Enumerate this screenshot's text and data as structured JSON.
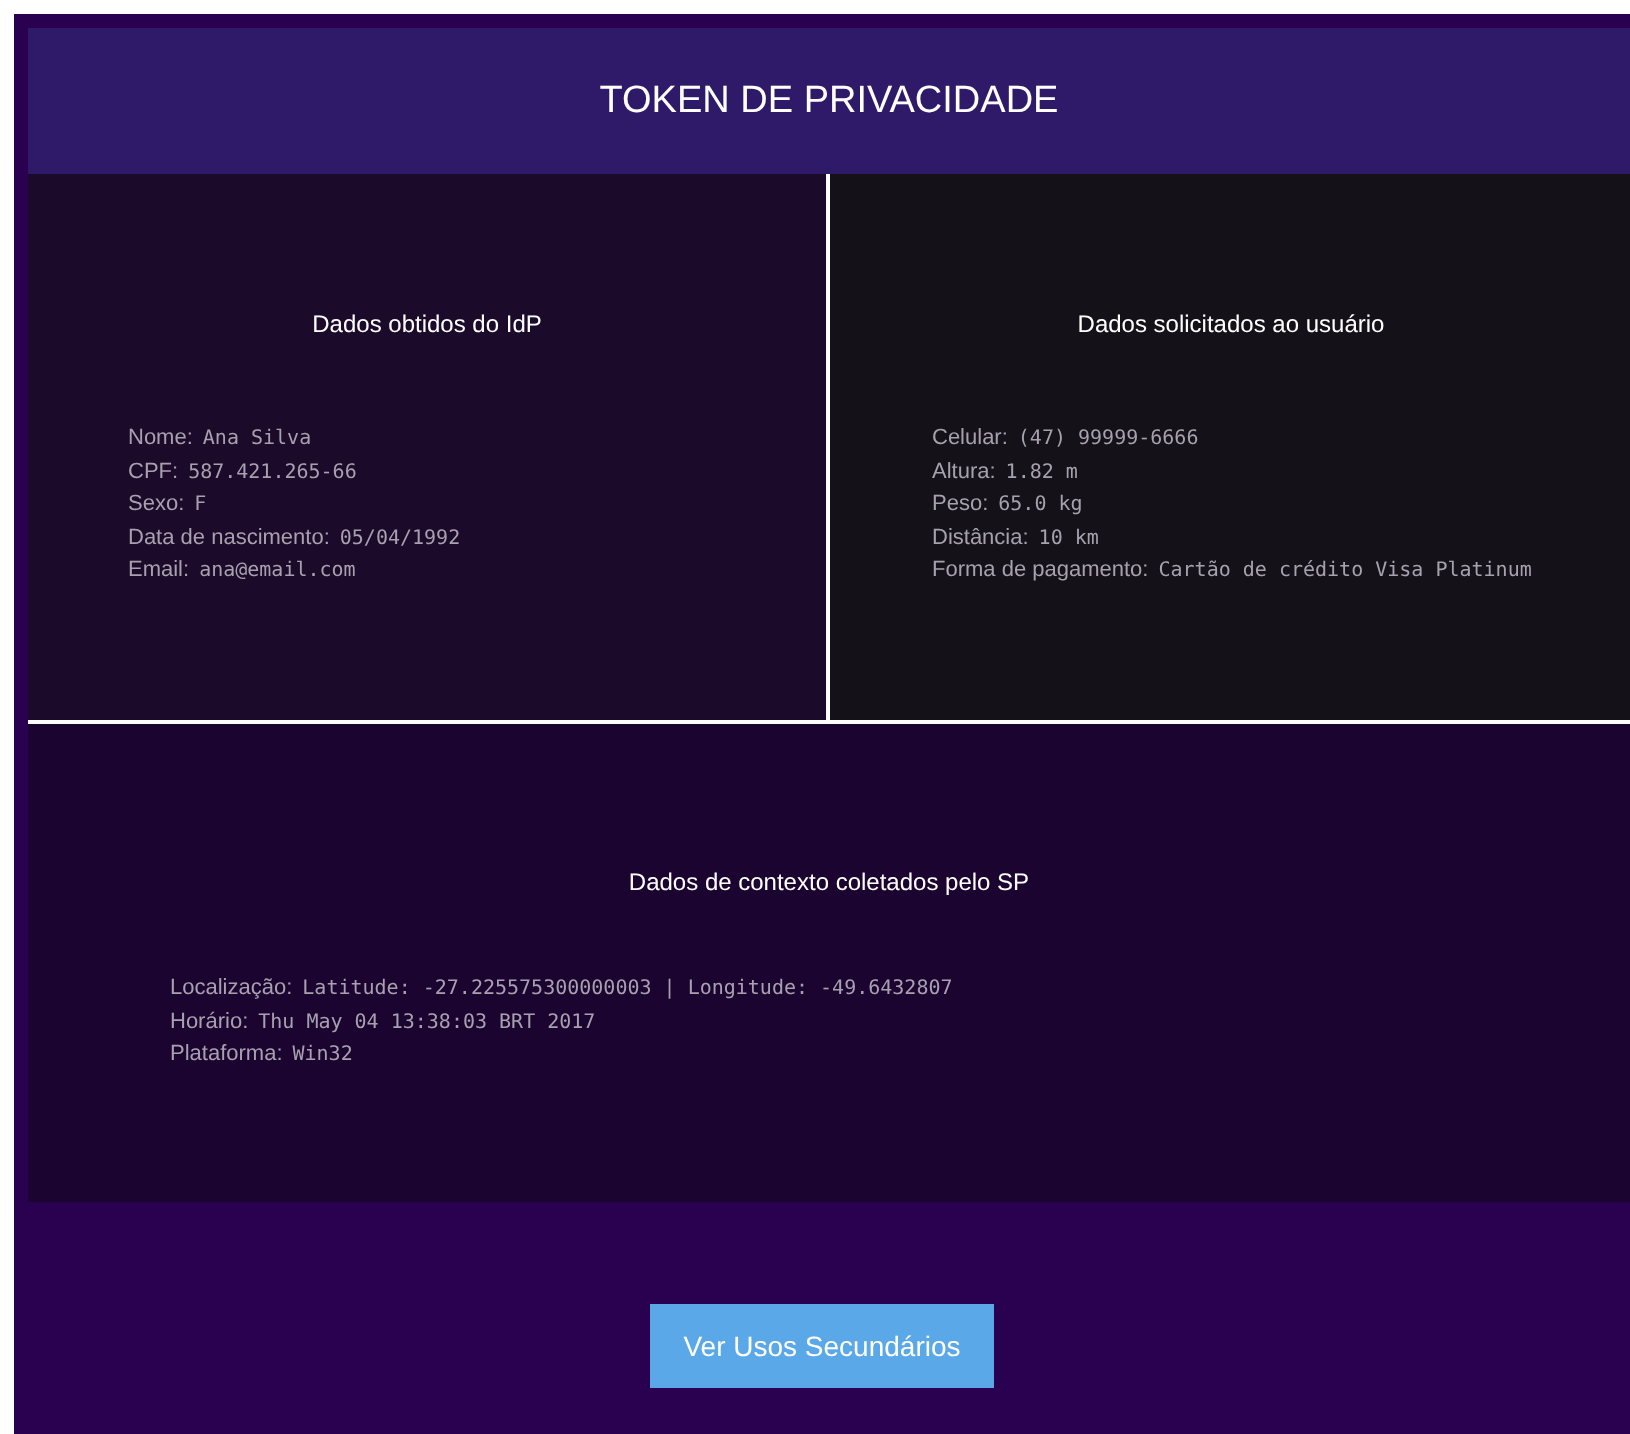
{
  "header": {
    "title": "TOKEN DE PRIVACIDADE"
  },
  "panels": [
    {
      "title": "Dados obtidos do IdP",
      "fields": [
        {
          "label": "Nome:",
          "value": "Ana Silva"
        },
        {
          "label": "CPF:",
          "value": "587.421.265-66"
        },
        {
          "label": "Sexo:",
          "value": "F"
        },
        {
          "label": "Data de nascimento:",
          "value": "05/04/1992"
        },
        {
          "label": "Email:",
          "value": "ana@email.com"
        }
      ]
    },
    {
      "title": "Dados solicitados ao usuário",
      "fields": [
        {
          "label": "Celular:",
          "value": "(47) 99999-6666"
        },
        {
          "label": "Altura:",
          "value": "1.82 m"
        },
        {
          "label": "Peso:",
          "value": "65.0 kg"
        },
        {
          "label": "Distância:",
          "value": "10 km"
        },
        {
          "label": "Forma de pagamento:",
          "value": "Cartão de crédito Visa Platinum"
        }
      ]
    }
  ],
  "context": {
    "title": "Dados de contexto coletados pelo SP",
    "fields": [
      {
        "label": "Localização:",
        "value": "Latitude: -27.225575300000003 | Longitude: -49.6432807"
      },
      {
        "label": "Horário:",
        "value": "Thu May 04 13:38:03 BRT 2017"
      },
      {
        "label": "Plataforma:",
        "value": "Win32"
      }
    ]
  },
  "button": {
    "label": "Ver Usos Secundários"
  }
}
